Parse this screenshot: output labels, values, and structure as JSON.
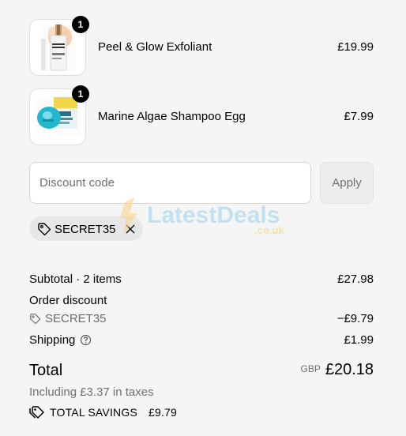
{
  "items": [
    {
      "name": "Peel & Glow Exfoliant",
      "price": "£19.99",
      "quantity": "1"
    },
    {
      "name": "Marine Algae Shampoo Egg",
      "price": "£7.99",
      "quantity": "1"
    }
  ],
  "discount": {
    "placeholder": "Discount code",
    "apply_label": "Apply",
    "applied_code": "SECRET35"
  },
  "watermark": {
    "text": "LatestDeals",
    "subtext": ".co.uk"
  },
  "summary": {
    "subtotal_label": "Subtotal",
    "subtotal_items": "· 2 items",
    "subtotal_value": "£27.98",
    "order_discount_label": "Order discount",
    "order_discount_code": "SECRET35",
    "order_discount_value": "−£9.79",
    "shipping_label": "Shipping",
    "shipping_value": "£1.99",
    "total_label": "Total",
    "total_currency": "GBP",
    "total_value": "£20.18",
    "taxes_text": "Including £3.37 in taxes",
    "savings_label": "TOTAL SAVINGS",
    "savings_value": "£9.79"
  },
  "colors": {
    "background": "#f5f5f5",
    "muted_text": "#707070",
    "badge": "#000000"
  }
}
